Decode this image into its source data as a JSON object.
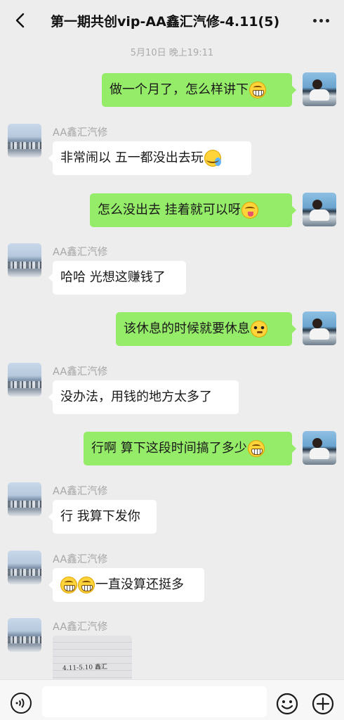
{
  "header": {
    "title": "第一期共创vip-AA鑫汇汽修-4.11(5)",
    "back_icon": "chevron-left-icon",
    "more_icon": "more-dots-icon"
  },
  "timestamp": "5月10日 晚上19:11",
  "messages": [
    {
      "side": "out",
      "text": "做一个月了，怎么样讲下",
      "emoji": "grin-emoji"
    },
    {
      "side": "in",
      "sender": "AA鑫汇汽修",
      "text": "非常闹以  五一都没出去玩",
      "emoji": "cry-laugh-emoji"
    },
    {
      "side": "out",
      "text": "怎么没出去   挂着就可以呀",
      "emoji": "silly-emoji"
    },
    {
      "side": "in",
      "sender": "AA鑫汇汽修",
      "text": "哈哈 光想这赚钱了"
    },
    {
      "side": "out",
      "text": "该休息的时候就要休息",
      "emoji": "flushed-emoji"
    },
    {
      "side": "in",
      "sender": "AA鑫汇汽修",
      "text": "没办法，用钱的地方太多了"
    },
    {
      "side": "out",
      "text": "行啊 算下这段时间搞了多少",
      "emoji": "grin-emoji"
    },
    {
      "side": "in",
      "sender": "AA鑫汇汽修",
      "text": "行 我算下发你"
    },
    {
      "side": "in",
      "sender": "AA鑫汇汽修",
      "text": "一直没算还挺多",
      "emoji": "grin-emoji"
    },
    {
      "side": "in",
      "sender": "AA鑫汇汽修",
      "image_text": "4.11-5.10 鑫汇"
    }
  ],
  "input": {
    "value": "",
    "placeholder": ""
  },
  "bottombar": {
    "voice_icon": "voice-icon",
    "emoji_icon": "emoji-icon",
    "plus_icon": "plus-icon"
  },
  "colors": {
    "background": "#ededed",
    "out_bubble": "#95ec69",
    "in_bubble": "#ffffff",
    "sender_name": "#a6a6a6"
  }
}
